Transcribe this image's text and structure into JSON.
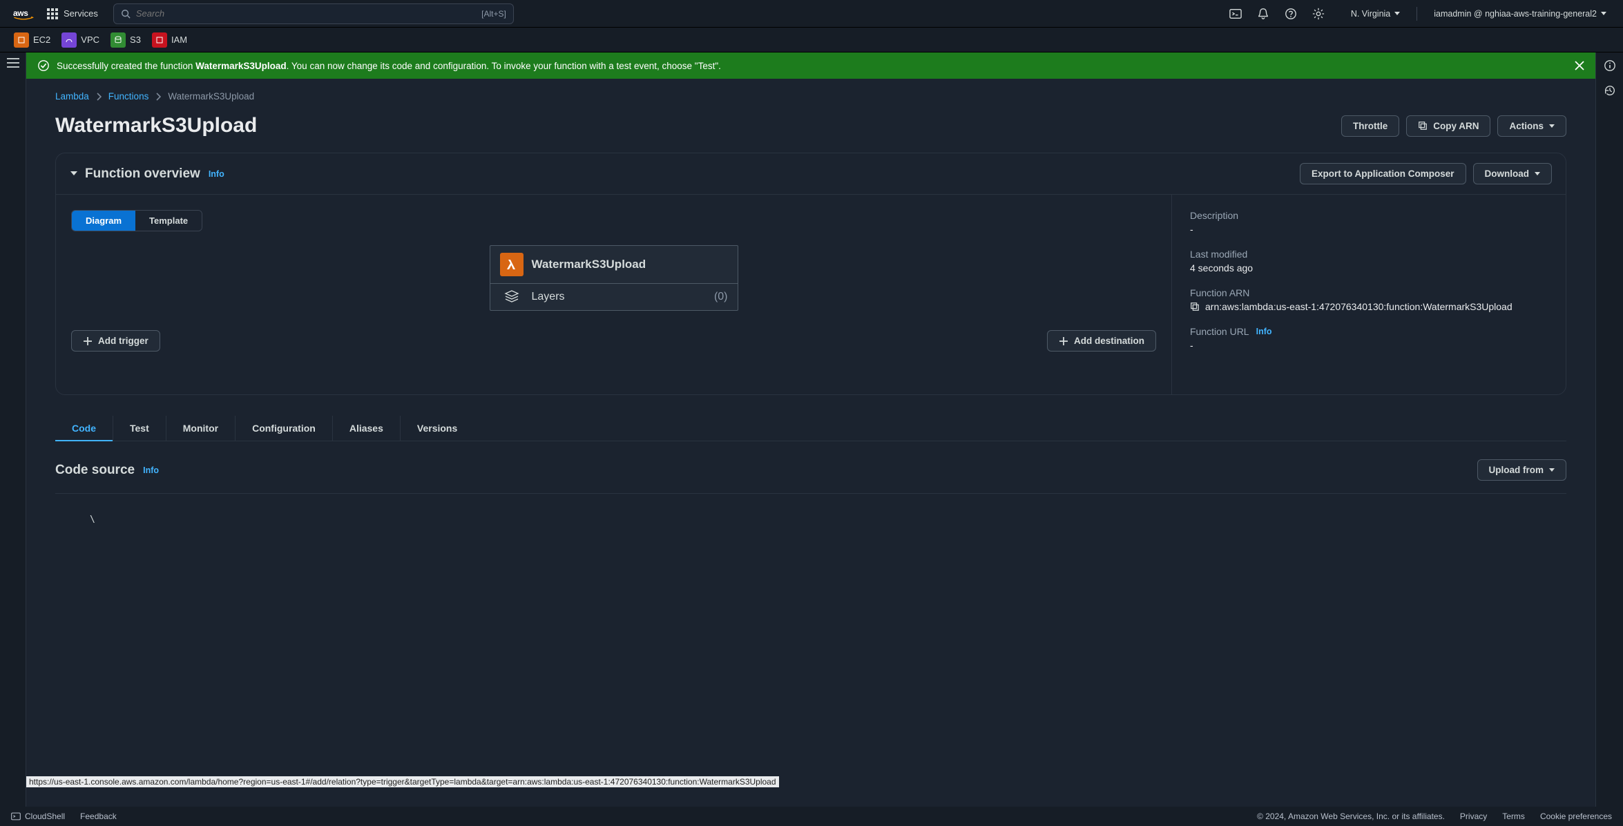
{
  "nav": {
    "services_label": "Services",
    "search_placeholder": "Search",
    "search_kbd": "[Alt+S]",
    "region": "N. Virginia",
    "user": "iamadmin @ nghiaa-aws-training-general2",
    "shortcuts": [
      {
        "label": "EC2",
        "color": "#d86613"
      },
      {
        "label": "VPC",
        "color": "#7545d6"
      },
      {
        "label": "S3",
        "color": "#318c33"
      },
      {
        "label": "IAM",
        "color": "#c7131f"
      }
    ]
  },
  "banner": {
    "prefix": "Successfully created the function ",
    "strong": "WatermarkS3Upload",
    "suffix": ". You can now change its code and configuration. To invoke your function with a test event, choose \"Test\"."
  },
  "breadcrumbs": {
    "root": "Lambda",
    "section": "Functions",
    "current": "WatermarkS3Upload"
  },
  "header": {
    "title": "WatermarkS3Upload",
    "throttle": "Throttle",
    "copy_arn": "Copy ARN",
    "actions": "Actions"
  },
  "overview": {
    "title": "Function overview",
    "info": "Info",
    "export": "Export to Application Composer",
    "download": "Download",
    "seg_diagram": "Diagram",
    "seg_template": "Template",
    "func_name": "WatermarkS3Upload",
    "layers_label": "Layers",
    "layers_count": "(0)",
    "add_trigger": "Add trigger",
    "add_destination": "Add destination"
  },
  "meta": {
    "description_label": "Description",
    "description_value": "-",
    "modified_label": "Last modified",
    "modified_value": "4 seconds ago",
    "arn_label": "Function ARN",
    "arn_value": "arn:aws:lambda:us-east-1:472076340130:function:WatermarkS3Upload",
    "url_label": "Function URL",
    "url_info": "Info",
    "url_value": "-"
  },
  "tabs": {
    "code": "Code",
    "test": "Test",
    "monitor": "Monitor",
    "config": "Configuration",
    "aliases": "Aliases",
    "versions": "Versions"
  },
  "code_source": {
    "title": "Code source",
    "info": "Info",
    "upload": "Upload from",
    "body": "\\"
  },
  "footer": {
    "cloudshell": "CloudShell",
    "feedback": "Feedback",
    "copyright": "© 2024, Amazon Web Services, Inc. or its affiliates.",
    "privacy": "Privacy",
    "terms": "Terms",
    "cookie": "Cookie preferences",
    "status_url": "https://us-east-1.console.aws.amazon.com/lambda/home?region=us-east-1#/add/relation?type=trigger&targetType=lambda&target=arn:aws:lambda:us-east-1:472076340130:function:WatermarkS3Upload"
  }
}
